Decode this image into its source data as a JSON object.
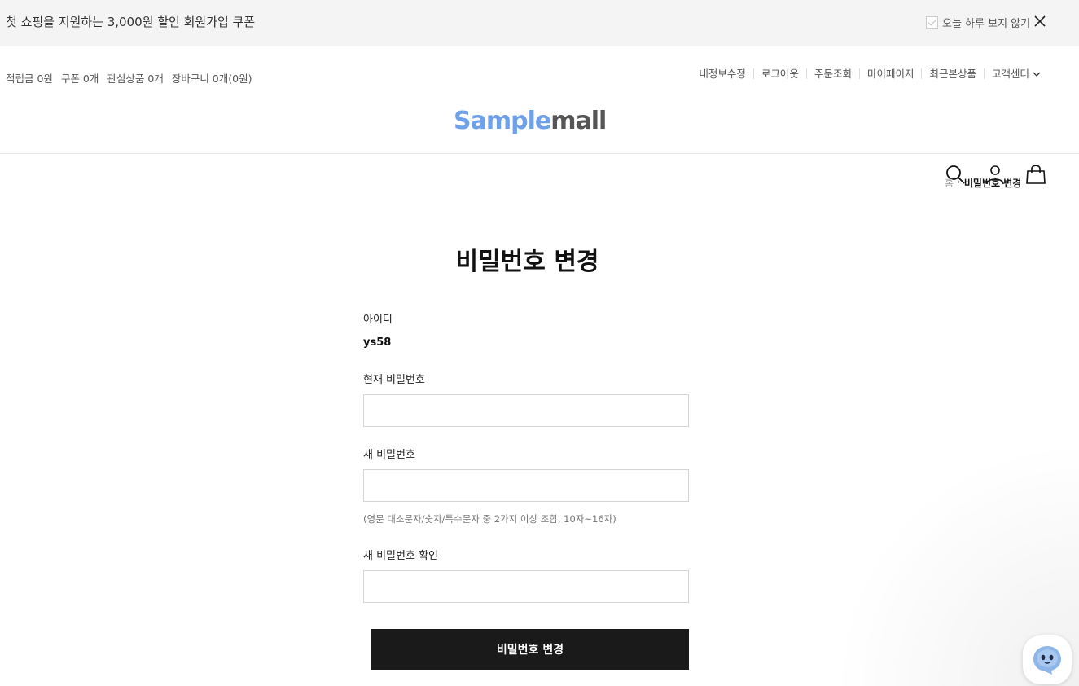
{
  "banner": {
    "text": "첫 쇼핑을 지원하는 3,000원 할인 회원가입 쿠폰",
    "dismiss_label": "오늘 하루 보지 않기"
  },
  "util_left": [
    "적립금 0원",
    "쿠폰 0개",
    "관심상품 0개",
    "장바구니 0개(0원)"
  ],
  "util_right": [
    "내정보수정",
    "로그아웃",
    "주문조회",
    "마이페이지",
    "최근본상품",
    "고객센터"
  ],
  "logo": {
    "part1": "Sample",
    "part2": "mall",
    "color1": "#6fa1ea",
    "color2": "#555555"
  },
  "breadcrumb": {
    "home": "홈",
    "sep": "›",
    "current": "비밀번호 변경"
  },
  "form": {
    "title": "비밀번호 변경",
    "id_label": "아이디",
    "id_value": "ys58",
    "current_pw_label": "현재 비밀번호",
    "current_pw_value": "",
    "new_pw_label": "새 비밀번호",
    "new_pw_value": "",
    "new_pw_hint": "(영문 대소문자/숫자/특수문자 중 2가지 이상 조합, 10자~16자)",
    "confirm_pw_label": "새 비밀번호 확인",
    "confirm_pw_value": "",
    "submit_label": "비밀번호 변경"
  },
  "icons": {
    "close": "close-icon",
    "search": "search-icon",
    "user": "user-icon",
    "cart": "shopping-bag-icon",
    "chat": "chatbot-icon",
    "dropdown": "chevron-down-icon"
  }
}
